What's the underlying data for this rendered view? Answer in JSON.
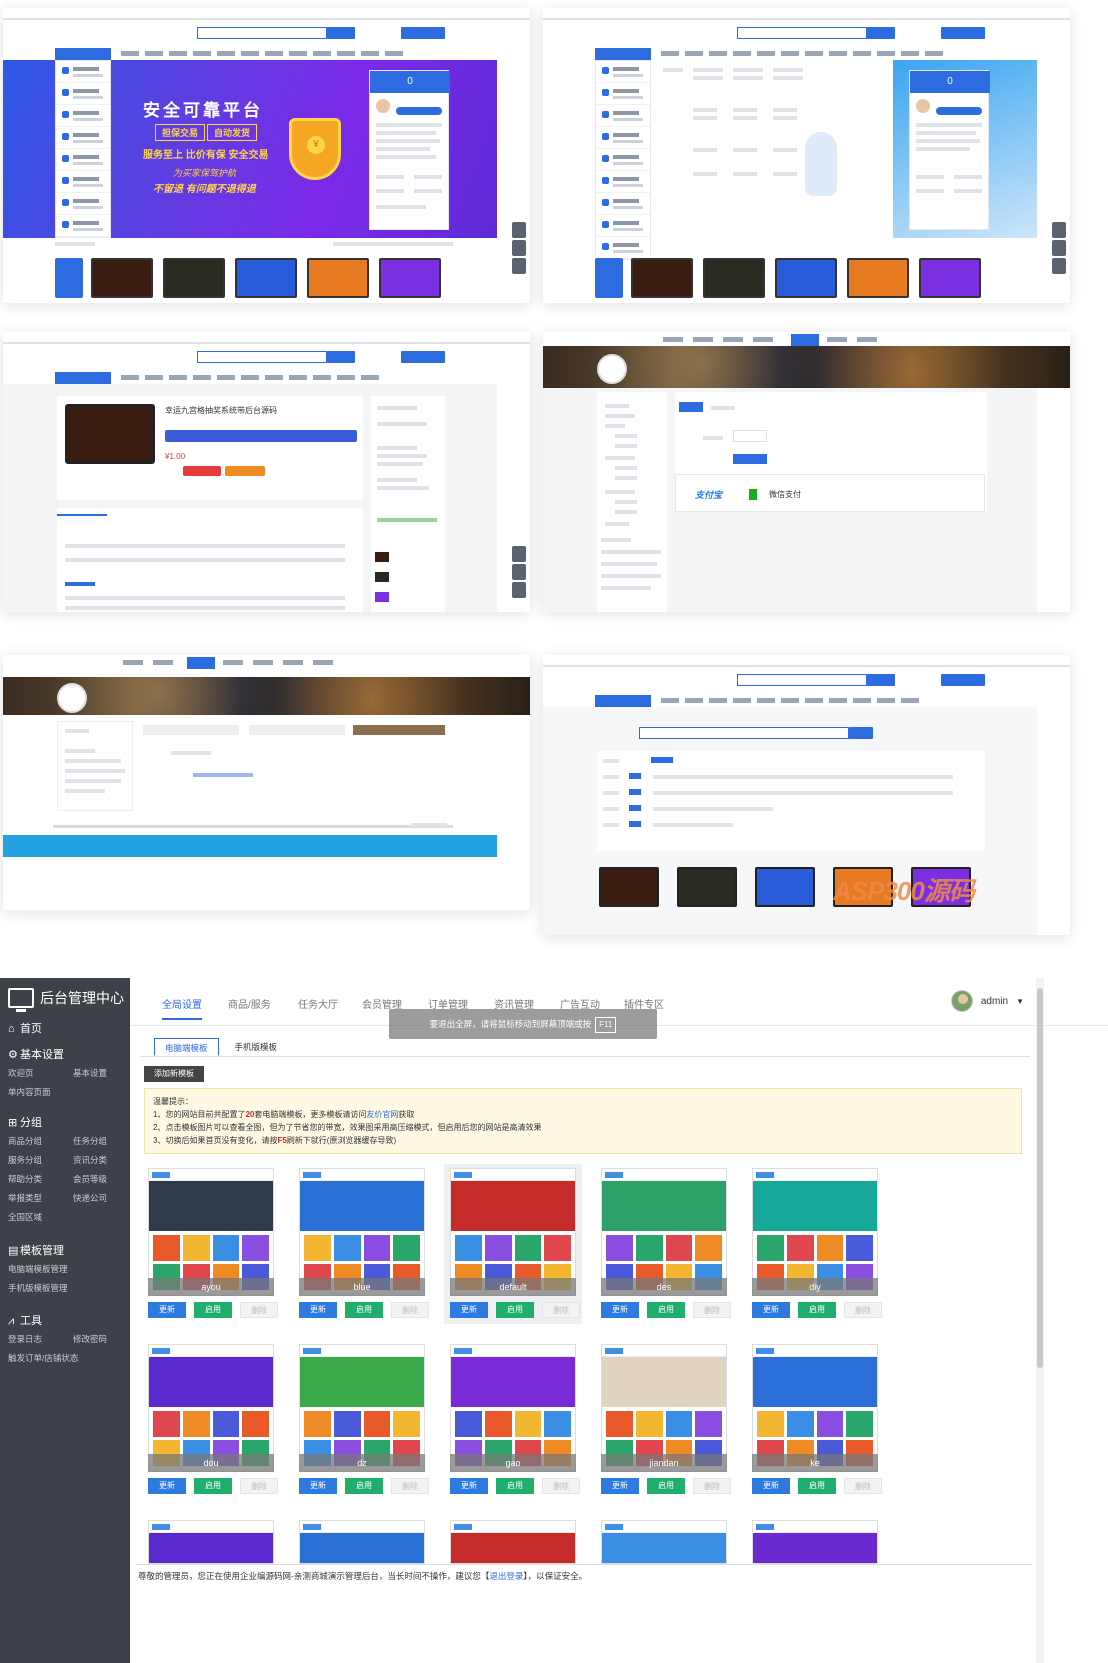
{
  "previews": {
    "hero_title": "安全可靠平台",
    "hero_tag1": "担保交易",
    "hero_tag2": "自动发货",
    "hero_line": "服务至上 比价有保 安全交易",
    "hero_script1": "为买家保驾护航",
    "hero_script2": "不留退 有问题不退得退",
    "counter": "0",
    "product_title": "幸运九宫格抽奖系统带后台源码",
    "product_price": "¥1.00",
    "alipay": "支付宝",
    "wechat": "微信支付",
    "watermark": "ASP300源码"
  },
  "sidebar": {
    "title": "后台管理中心",
    "home": "首页",
    "sections": [
      {
        "title": "基本设置",
        "icon": "gear-icon",
        "rows": [
          [
            "欢迎页",
            "基本设置"
          ],
          [
            "单内容页面",
            ""
          ]
        ]
      },
      {
        "title": "分组",
        "icon": "grid-icon",
        "rows": [
          [
            "商品分组",
            "任务分组"
          ],
          [
            "服务分组",
            "资讯分类"
          ],
          [
            "帮助分类",
            "会员等级"
          ],
          [
            "举报类型",
            "快递公司"
          ],
          [
            "全国区域",
            ""
          ]
        ]
      },
      {
        "title": "模板管理",
        "icon": "template-icon",
        "rows": [
          [
            "电脑端模板管理",
            ""
          ],
          [
            "手机版模板管理",
            ""
          ]
        ]
      },
      {
        "title": "工具",
        "icon": "chart-icon",
        "rows": [
          [
            "登录日志",
            "修改密码"
          ],
          [
            "触发订单/店铺状态",
            ""
          ]
        ]
      }
    ]
  },
  "topnav": {
    "items": [
      "全局设置",
      "商品/服务",
      "任务大厅",
      "会员管理",
      "订单管理",
      "资讯管理",
      "广告互动",
      "插件专区"
    ],
    "user": "admin"
  },
  "tip": {
    "text": "要退出全屏，请将鼠标移动到屏幕顶端或按",
    "key": "F11"
  },
  "subtabs": [
    "电脑端模板",
    "手机版模板"
  ],
  "add_button": "添加新模板",
  "notice": {
    "title": "温馨提示：",
    "l1a": "1、您的网站目前共配置了",
    "l1num": "20",
    "l1b": "套电脑端模板，更多模板请访问",
    "l1link": "友价官网",
    "l1c": "获取",
    "l2": "2、点击模板图片可以查看全图，但为了节省您的带宽，效果图采用高压缩模式，但启用后您的网站是高清效果",
    "l3a": "3、切换后如果首页没有变化，请按",
    "l3key": "F5",
    "l3b": "刷新下就行(原浏览器缓存导致)"
  },
  "templates": [
    {
      "name": "ayou",
      "theme": "#2f3a4a"
    },
    {
      "name": "blue",
      "theme": "#2a6fd6"
    },
    {
      "name": "default",
      "theme": "#c62b2b"
    },
    {
      "name": "des",
      "theme": "#2ea06a"
    },
    {
      "name": "diy",
      "theme": "#17a89a"
    },
    {
      "name": "dou",
      "theme": "#5a2ad0"
    },
    {
      "name": "dz",
      "theme": "#3aaa4a"
    },
    {
      "name": "gao",
      "theme": "#7a2bd8"
    },
    {
      "name": "jiandan",
      "theme": "#e0d4c0"
    },
    {
      "name": "ke",
      "theme": "#2c6ed8"
    }
  ],
  "btn": {
    "update": "更新",
    "enable": "启用",
    "delete": "删除"
  },
  "footer": {
    "text": "尊敬的管理员，您正在使用企业编源码网-亲测商城演示管理后台，当长时间不操作，建议您【",
    "link": "退出登录",
    "text2": "】，以保证安全。"
  },
  "colors": {
    "accent": "#2d6be0",
    "sidebar": "#3e4248",
    "enable": "#1fae6b"
  }
}
